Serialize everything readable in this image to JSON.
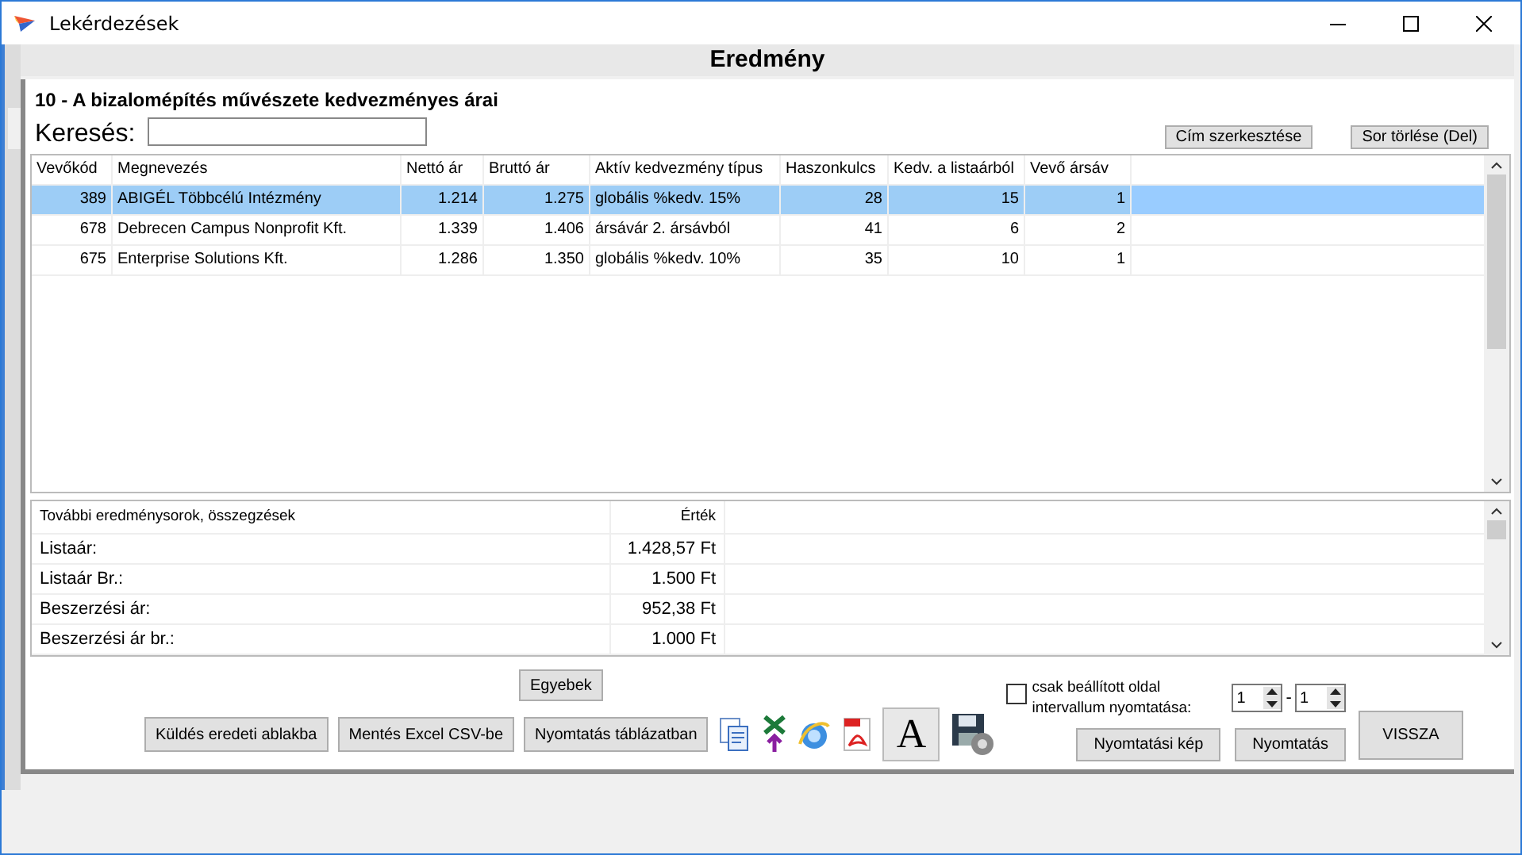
{
  "window": {
    "title": "Lekérdezések"
  },
  "header": "Eredmény",
  "report_title": "10 - A bizalomépítés művészete kedvezményes árai",
  "search": {
    "label": "Keresés:"
  },
  "top_buttons": [
    "Cím szerkesztése",
    "Sor törlése (Del)"
  ],
  "table": {
    "columns": [
      "Vevőkód",
      "Megnevezés",
      "Nettó ár",
      "Bruttó ár",
      "Aktív kedvezmény típus",
      "Haszonkulcs",
      "Kedv. a listaárból",
      "Vevő ársáv"
    ],
    "rows": [
      {
        "selected": true,
        "cells": [
          "389",
          "ABIGÉL Többcélú Intézmény",
          "1.214",
          "1.275",
          "globális %kedv. 15%",
          "28",
          "15",
          "1"
        ]
      },
      {
        "selected": false,
        "cells": [
          "678",
          "Debrecen Campus Nonprofit Kft.",
          "1.339",
          "1.406",
          "ársávár 2. ársávból",
          "41",
          "6",
          "2"
        ]
      },
      {
        "selected": false,
        "cells": [
          "675",
          "Enterprise Solutions Kft.",
          "1.286",
          "1.350",
          "globális %kedv. 10%",
          "35",
          "10",
          "1"
        ]
      }
    ]
  },
  "summary": {
    "columns": [
      "További eredménysorok, összegzések",
      "Érték"
    ],
    "rows": [
      [
        "Listaár:",
        "1.428,57 Ft"
      ],
      [
        "Listaár Br.:",
        "1.500 Ft"
      ],
      [
        "Beszerzési ár:",
        "952,38 Ft"
      ],
      [
        "Beszerzési ár br.:",
        "1.000 Ft"
      ]
    ]
  },
  "other_button": "Egyebek",
  "action_buttons": [
    "Küldés eredeti ablakba",
    "Mentés Excel CSV-be",
    "Nyomtatás táblázatban"
  ],
  "font_button": "A",
  "page_range": {
    "checked": false,
    "label": "csak beállított oldal intervallum nyomtatása:",
    "from": "1",
    "separator": "-",
    "to": "1"
  },
  "print_buttons": [
    "Nyomtatási kép",
    "Nyomtatás"
  ],
  "back_button": "VISSZA"
}
